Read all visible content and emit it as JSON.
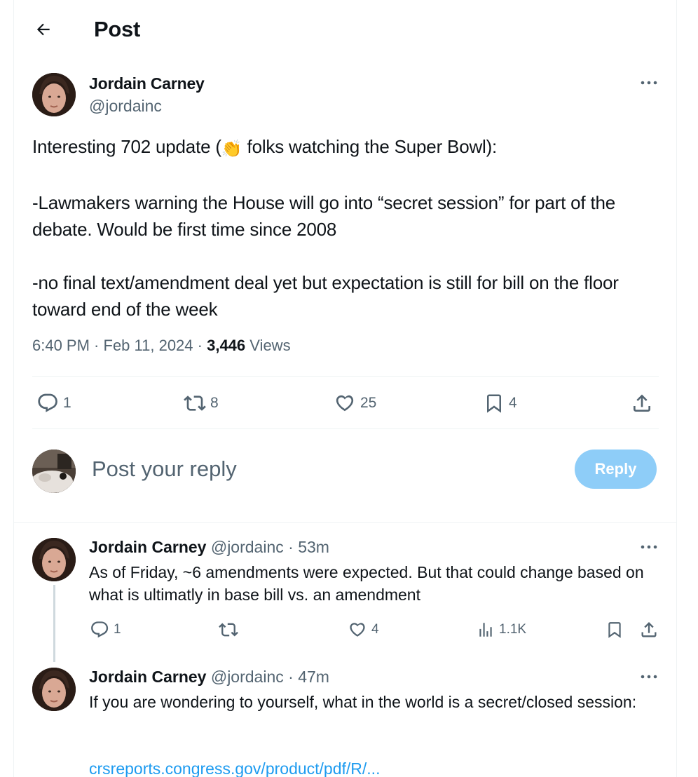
{
  "header": {
    "title": "Post"
  },
  "post": {
    "author_name": "Jordain Carney",
    "handle": "@jordainc",
    "text_before_emoji": "Interesting 702 update (",
    "emoji": "👏",
    "text_after_emoji": " folks watching the Super Bowl):",
    "para2": "-Lawmakers warning the House will go into “secret session” for part of the debate. Would be first time since 2008",
    "para3": "-no final text/amendment deal yet but expectation is still for bill on the floor toward end of the week",
    "time": "6:40 PM",
    "date": "Feb 11, 2024",
    "views_count": "3,446",
    "views_label": "Views",
    "separator": " · ",
    "replies": "1",
    "reposts": "8",
    "likes": "25",
    "bookmarks": "4"
  },
  "composer": {
    "placeholder": "Post your reply",
    "button": "Reply"
  },
  "thread": [
    {
      "author_name": "Jordain Carney",
      "handle": "@jordainc",
      "time": "53m",
      "text": "As of Friday, ~6 amendments were expected. But that could change based on what is ultimatly in base bill vs. an amendment",
      "replies": "1",
      "reposts": "",
      "likes": "4",
      "views": "1.1K"
    },
    {
      "author_name": "Jordain Carney",
      "handle": "@jordainc",
      "time": "47m",
      "text": "If you are wondering to yourself, what in the world is a secret/closed session:",
      "link": "crsreports.congress.gov/product/pdf/R/..."
    }
  ],
  "colors": {
    "accent": "#1d9bf0",
    "reply_button_disabled": "#8ecdf8",
    "muted": "#536471",
    "divider": "#eff3f4"
  }
}
